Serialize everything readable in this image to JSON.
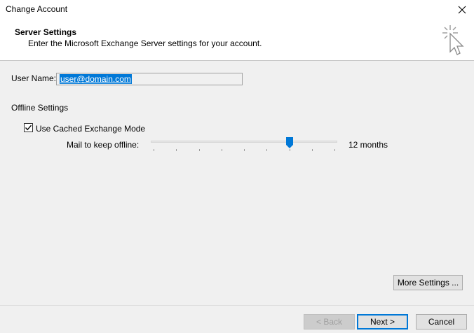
{
  "window": {
    "title": "Change Account",
    "close_icon": "close-icon"
  },
  "header": {
    "title": "Server Settings",
    "subtitle": "Enter the Microsoft Exchange Server settings for your account.",
    "icon": "sparkle-cursor-icon"
  },
  "user": {
    "label": "User Name:",
    "value": "user@domain.com"
  },
  "offline": {
    "section_label": "Offline Settings",
    "cached_mode_label": "Use Cached Exchange Mode",
    "cached_mode_checked": true,
    "mail_keep_label": "Mail to keep offline:",
    "slider_value_text": "12 months",
    "slider_position_index": 6,
    "slider_tick_count": 9
  },
  "buttons": {
    "more_settings": "More Settings ...",
    "back": "< Back",
    "next": "Next >",
    "cancel": "Cancel"
  },
  "colors": {
    "accent": "#0078d7"
  }
}
